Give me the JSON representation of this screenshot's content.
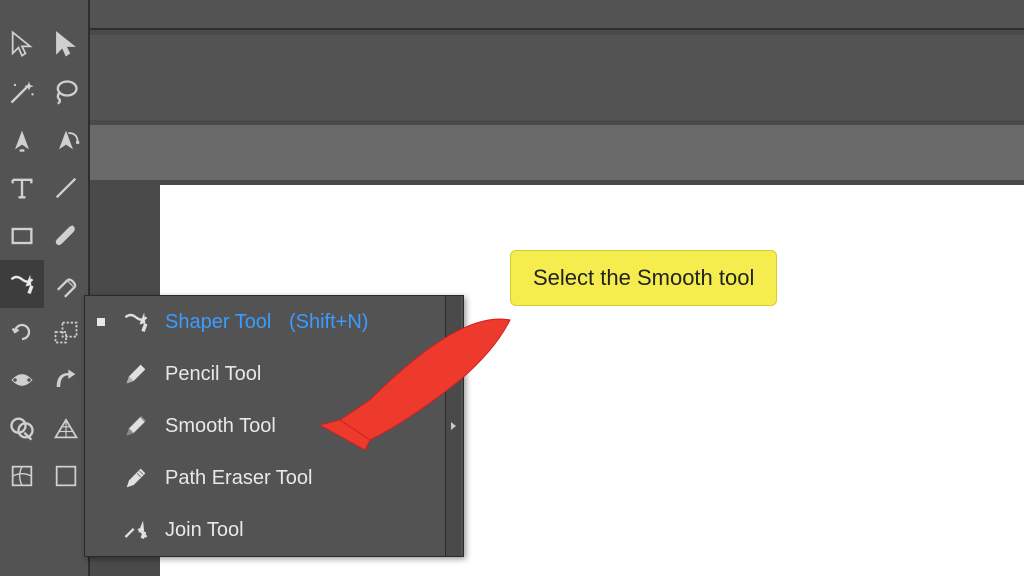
{
  "callout": {
    "text": "Select the Smooth tool"
  },
  "flyout": {
    "items": [
      {
        "name": "Shaper Tool",
        "shortcut": "(Shift+N)",
        "icon": "shaper-icon",
        "active": true
      },
      {
        "name": "Pencil Tool",
        "shortcut": "",
        "icon": "pencil-icon",
        "active": false
      },
      {
        "name": "Smooth Tool",
        "shortcut": "",
        "icon": "smooth-icon",
        "active": false
      },
      {
        "name": "Path Eraser Tool",
        "shortcut": "",
        "icon": "path-eraser-icon",
        "active": false
      },
      {
        "name": "Join Tool",
        "shortcut": "",
        "icon": "join-icon",
        "active": false
      }
    ]
  },
  "toolbar": {
    "rows": [
      [
        "selection-icon",
        "direct-selection-icon"
      ],
      [
        "magic-wand-icon",
        "lasso-icon"
      ],
      [
        "pen-icon",
        "curvature-icon"
      ],
      [
        "type-icon",
        "line-icon"
      ],
      [
        "rectangle-icon",
        "paintbrush-icon"
      ],
      [
        "shaper-icon",
        "eraser-icon"
      ],
      [
        "rotate-icon",
        "scale-icon"
      ],
      [
        "width-icon",
        "warp-icon"
      ],
      [
        "shape-builder-icon",
        "perspective-icon"
      ],
      [
        "mesh-icon",
        "gradient-icon"
      ]
    ],
    "selected": "shaper-icon"
  }
}
